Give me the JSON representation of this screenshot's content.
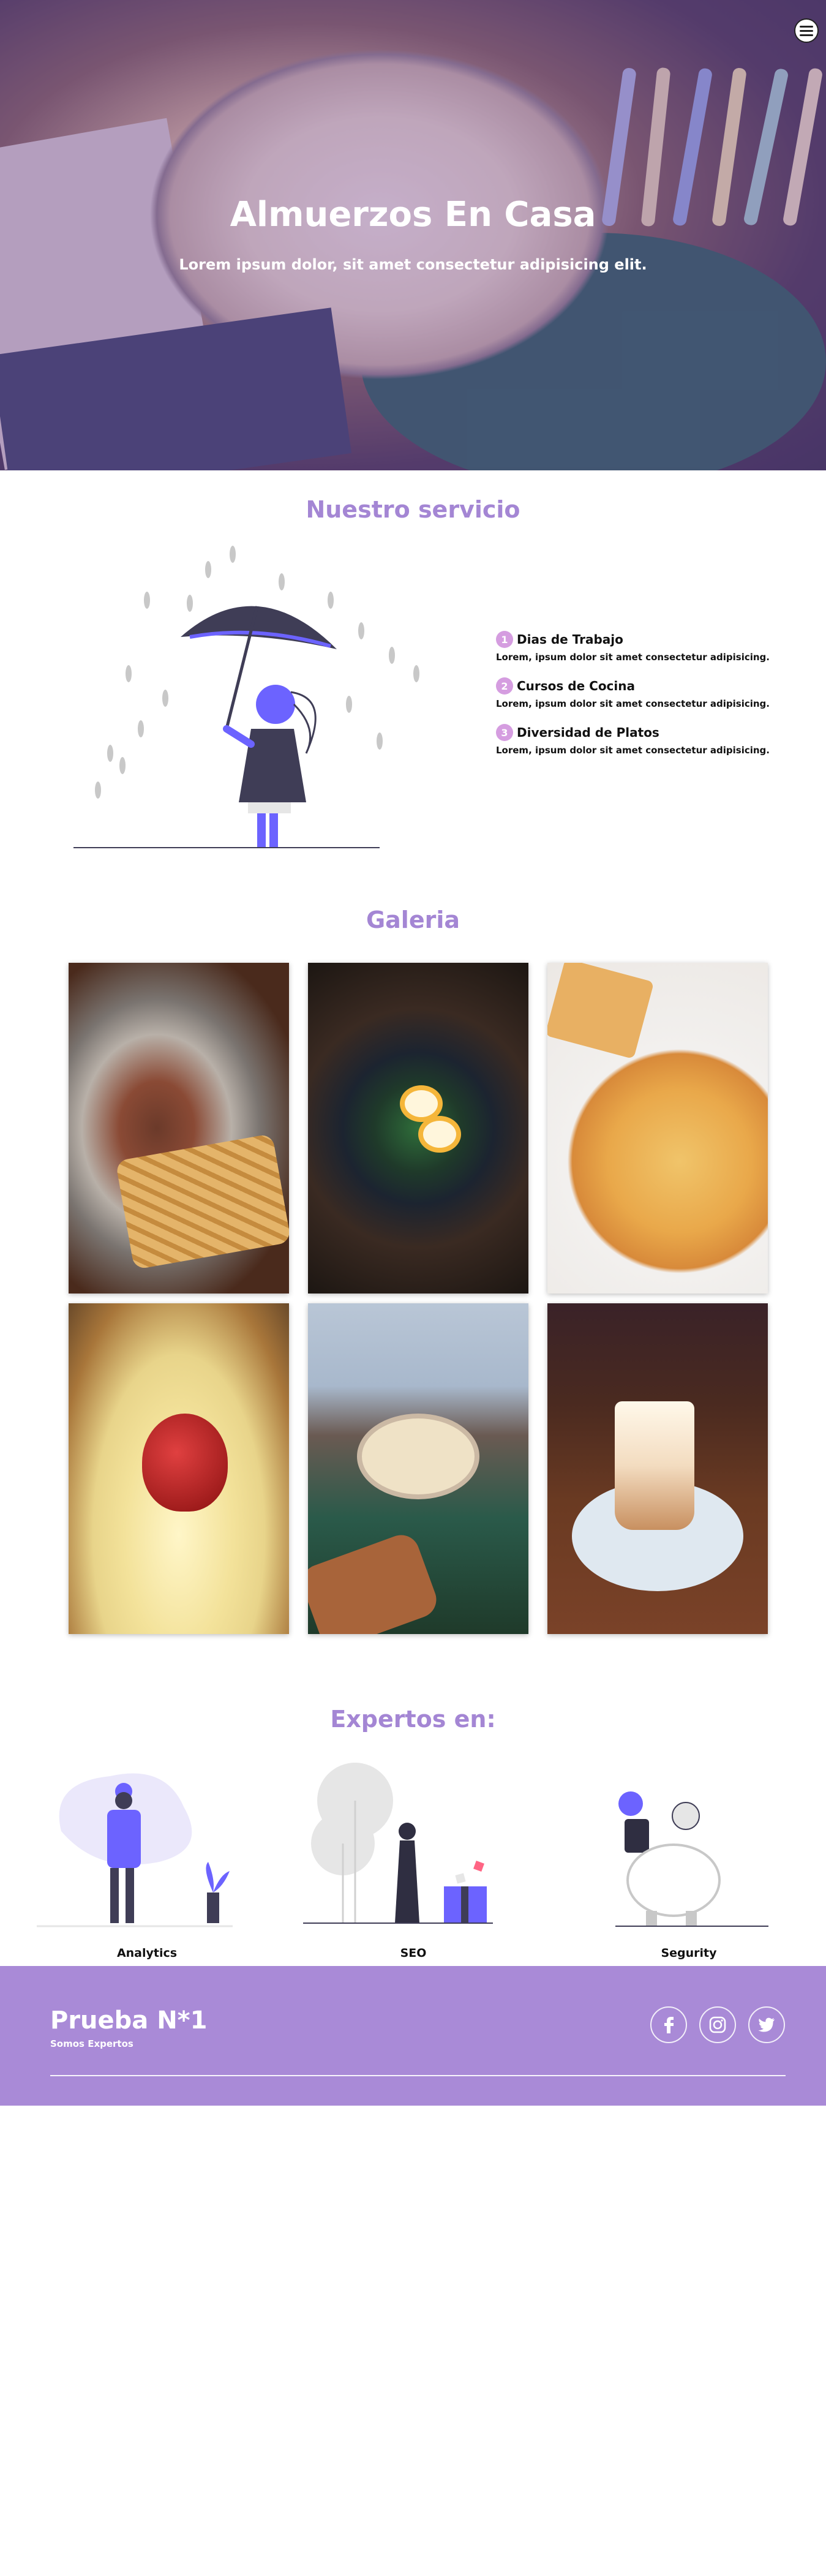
{
  "hero": {
    "title": "Almuerzos En Casa",
    "subtitle": "Lorem ipsum dolor, sit amet consectetur adipisicing elit."
  },
  "nav": {
    "menu_icon": "hamburger-menu-icon"
  },
  "service": {
    "title": "Nuestro servicio",
    "items": [
      {
        "num": "1",
        "title": "Dias de Trabajo",
        "desc": "Lorem, ipsum dolor sit amet consectetur adipisicing."
      },
      {
        "num": "2",
        "title": "Cursos de Cocina",
        "desc": "Lorem, ipsum dolor sit amet consectetur adipisicing."
      },
      {
        "num": "3",
        "title": "Diversidad de Platos",
        "desc": "Lorem, ipsum dolor sit amet consectetur adipisicing."
      }
    ]
  },
  "gallery": {
    "title": "Galeria",
    "images": [
      "steak-with-fries",
      "eggs-salad",
      "pizza",
      "strawberry-cheesecake",
      "pan-dish-table",
      "iced-coffee-drink"
    ]
  },
  "experts": {
    "title": "Expertos en:",
    "items": [
      {
        "label": "Analytics"
      },
      {
        "label": "SEO"
      },
      {
        "label": "Segurity"
      }
    ]
  },
  "footer": {
    "brand": "Prueba N*1",
    "tagline": "Somos Expertos",
    "social": [
      "facebook-icon",
      "instagram-icon",
      "twitter-icon"
    ]
  },
  "colors": {
    "accent": "#a486d4",
    "footer": "#a98ad7",
    "badge": "#d59de0",
    "illustration": "#6c63ff"
  }
}
